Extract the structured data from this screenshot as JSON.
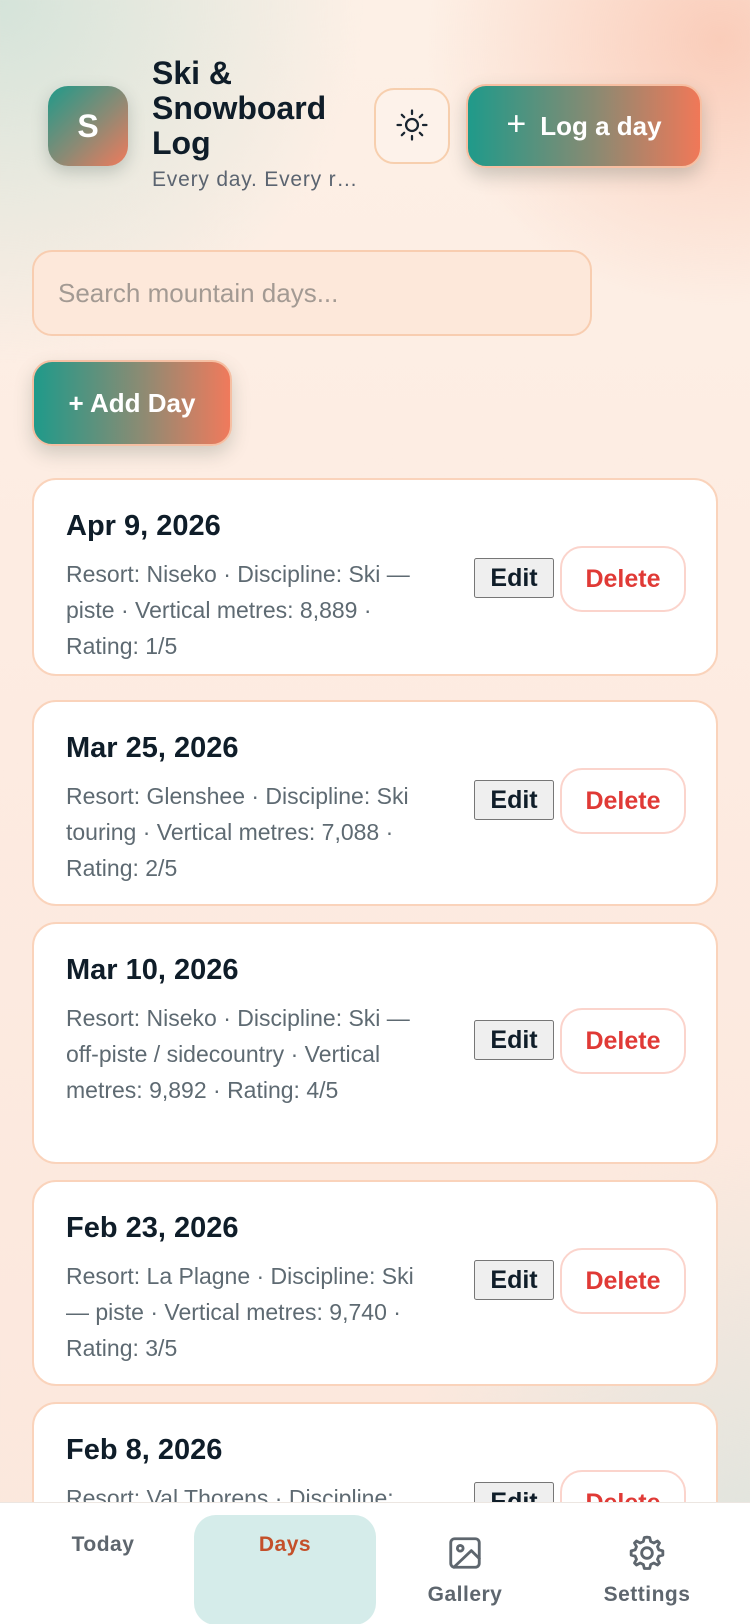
{
  "header": {
    "logo_letter": "S",
    "title": "Ski & Snowboard Log",
    "subtitle": "Every day. Every run.",
    "log_day_label": "Log a day",
    "theme_icon": "sun-icon"
  },
  "search": {
    "placeholder": "Search mountain days...",
    "value": ""
  },
  "add_day_label": "+ Add Day",
  "days": [
    {
      "date": "Apr 9, 2026",
      "description": "Resort: Niseko · Discipline: Ski — piste · Vertical metres: 8,889 · Rating: 1/5",
      "edit_label": "Edit",
      "delete_label": "Delete"
    },
    {
      "date": "Mar 25, 2026",
      "description": "Resort: Glenshee · Discipline: Ski touring · Vertical metres: 7,088 · Rating: 2/5",
      "edit_label": "Edit",
      "delete_label": "Delete"
    },
    {
      "date": "Mar 10, 2026",
      "description": "Resort: Niseko · Discipline: Ski — off-piste / sidecountry · Vertical metres: 9,892 · Rating: 4/5",
      "edit_label": "Edit",
      "delete_label": "Delete"
    },
    {
      "date": "Feb 23, 2026",
      "description": "Resort: La Plagne · Discipline: Ski — piste · Vertical metres: 9,740 · Rating: 3/5",
      "edit_label": "Edit",
      "delete_label": "Delete"
    },
    {
      "date": "Feb 8, 2026",
      "description": "Resort: Val Thorens · Discipline:",
      "edit_label": "Edit",
      "delete_label": "Delete"
    }
  ],
  "nav": {
    "tabs": [
      {
        "label": "Today",
        "icon": "",
        "active": false
      },
      {
        "label": "Days",
        "icon": "",
        "active": true
      },
      {
        "label": "Gallery",
        "icon": "image-icon",
        "active": false
      },
      {
        "label": "Settings",
        "icon": "gear-icon",
        "active": false
      }
    ]
  },
  "colors": {
    "accent_teal": "#1f9a8a",
    "accent_coral": "#f07a5c",
    "delete_red": "#e03a36",
    "active_tab_bg": "#d5ecea",
    "active_tab_text": "#c4502a"
  }
}
